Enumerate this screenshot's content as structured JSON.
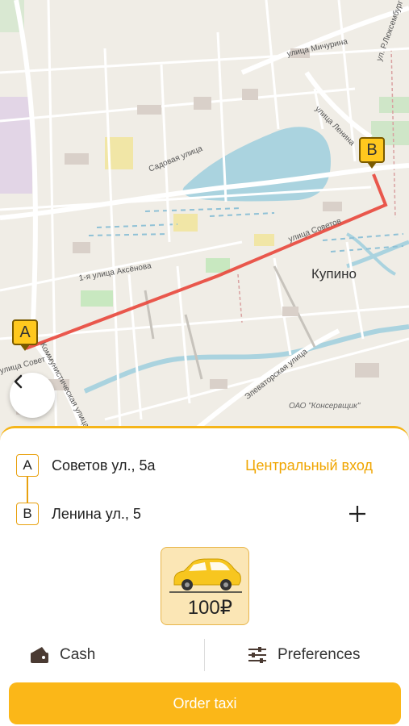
{
  "map": {
    "streets": {
      "michurina": "улица Мичурина",
      "luxemburg": "ул. Р.Люксембург",
      "lenina": "улица Ленина",
      "sadovaya": "Садовая улица",
      "sovetov": "улица Советов",
      "aksenova": "1-я улица Аксёнова",
      "kommunisticheskaya": "Коммунистическая улица",
      "elevatornaya": "Элеваторская улица",
      "sovet_short": "улица Совет"
    },
    "city": "Купино",
    "org": "ОАО \"Консервщик\"",
    "pin_a": "A",
    "pin_b": "B"
  },
  "back_icon": "chevron-left-icon",
  "route": {
    "from": {
      "letter": "A",
      "address": "Советов ул., 5а",
      "entrance": "Центральный вход"
    },
    "to": {
      "letter": "B",
      "address": "Ленина ул., 5"
    },
    "add_icon": "plus-icon"
  },
  "tariff": {
    "icon": "car-icon",
    "price": "100₽"
  },
  "payment": {
    "cash_label": "Cash",
    "cash_icon": "wallet-icon",
    "preferences_label": "Preferences",
    "preferences_icon": "sliders-icon"
  },
  "order_button": "Order taxi",
  "colors": {
    "accent": "#fbb718",
    "route": "#e8463b",
    "pin": "#ffc81e",
    "entrance_text": "#f0a500"
  }
}
